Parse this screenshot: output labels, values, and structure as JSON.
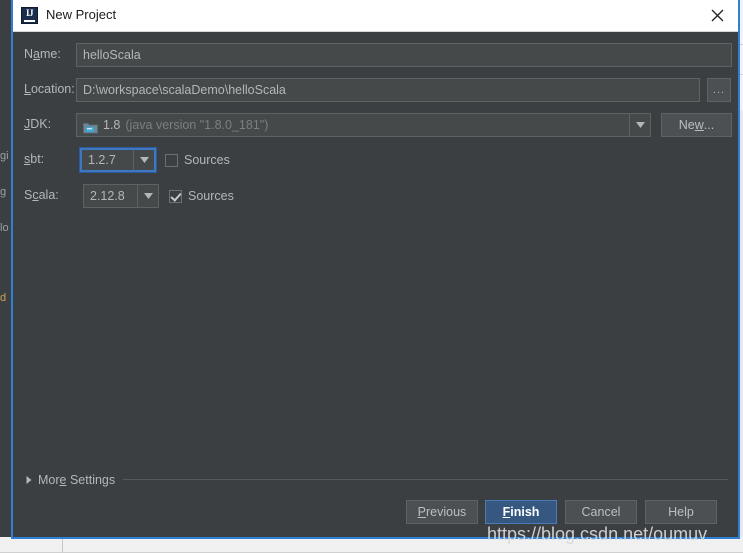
{
  "window": {
    "title": "New Project",
    "logo_text": "IJ",
    "close_icon": "close-icon"
  },
  "form": {
    "name": {
      "label_pre": "N",
      "label_mnemonic": "a",
      "label_post": "me:",
      "value": "helloScala"
    },
    "location": {
      "label_pre": "",
      "label_mnemonic": "L",
      "label_post": "ocation:",
      "value": "D:\\workspace\\scalaDemo\\helloScala",
      "browse_label": "..."
    },
    "jdk": {
      "label_pre": "",
      "label_mnemonic": "J",
      "label_post": "DK:",
      "value": "1.8",
      "value_detail": "(java version \"1.8.0_181\")",
      "icon": "jdk-folder-icon",
      "new_button_pre": "Ne",
      "new_button_mnemonic": "w",
      "new_button_post": "..."
    },
    "sbt": {
      "label_pre": "",
      "label_mnemonic": "s",
      "label_post": "bt:",
      "value": "1.2.7",
      "focused": true,
      "sources_label": "Sources",
      "sources_checked": false
    },
    "scala": {
      "label_pre": "S",
      "label_mnemonic": "c",
      "label_post": "ala:",
      "value": "2.12.8",
      "focused": false,
      "sources_label": "Sources",
      "sources_checked": true
    }
  },
  "more_settings": {
    "label_pre": "Mor",
    "label_mnemonic": "e",
    "label_post": " Settings",
    "expanded": false
  },
  "buttons": {
    "previous": {
      "pre": "",
      "mnemonic": "P",
      "post": "revious"
    },
    "finish": {
      "pre": "",
      "mnemonic": "F",
      "post": "inish",
      "is_default": true
    },
    "cancel": {
      "pre": "Cancel",
      "mnemonic": "",
      "post": ""
    },
    "help": {
      "pre": "Help",
      "mnemonic": "",
      "post": ""
    }
  },
  "watermark": {
    "text": "https://blog.csdn.net/oumuv"
  },
  "backdrop": {
    "left_fragments": [
      "gi",
      "g",
      "lo",
      "d"
    ]
  },
  "colors": {
    "dialog_bg": "#3c3f41",
    "field_bg": "#45494a",
    "border": "#5e6264",
    "text": "#b4b7ba",
    "accent_blue": "#2f7fd6",
    "default_button": "#365880",
    "titlebar_bg": "#ffffff"
  }
}
